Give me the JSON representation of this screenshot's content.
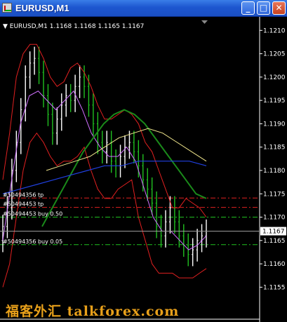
{
  "window": {
    "title": "EURUSD,M1",
    "buttons": {
      "minimize": "_",
      "maximize": "□",
      "close": "✕"
    }
  },
  "chart_info": "▼ EURUSD,M1  1.1168 1.1168 1.1165 1.1167",
  "watermark": "福客外汇 talkforex.com",
  "price_axis": {
    "labels": [
      "1.1210",
      "1.1205",
      "1.1200",
      "1.1195",
      "1.1190",
      "1.1185",
      "1.1180",
      "1.1175",
      "1.1170",
      "1.1165",
      "1.1160",
      "1.1155"
    ],
    "current_price": "1.1167"
  },
  "order_lines": [
    {
      "label": "#50494356 tp",
      "price": 1.11741,
      "color": "#e02020",
      "show_label": true
    },
    {
      "label": "#50494453 tp",
      "price": 1.11721,
      "color": "#e02020",
      "show_label": true
    },
    {
      "label": "#50494453 buy 0.50",
      "price": 1.117,
      "color": "#20c020",
      "show_label": true
    },
    {
      "label": "#50494356 buy 0.05",
      "price": 1.11641,
      "color": "#20c020",
      "show_label": true
    }
  ],
  "colors": {
    "background": "#000000",
    "up_bar": "#ffffff",
    "down_bar": "#20c020",
    "bollinger": "#e02020",
    "ma_fast": "#ffffff",
    "ma_violet": "#d070ff",
    "ma_green": "#1a8a1a",
    "ma_khaki": "#f0e68c",
    "ma_blue": "#2040e0"
  },
  "chart_data": {
    "type": "line",
    "ylim": [
      1.1151,
      1.1212
    ],
    "x_count": 60,
    "series": [
      {
        "key": "close",
        "values": [
          1.1168,
          1.1172,
          1.118,
          1.1186,
          1.1193,
          1.12,
          1.1203,
          1.1204,
          1.1201,
          1.1196,
          1.1192,
          1.1188,
          1.1191,
          1.1194,
          1.1196,
          1.1195,
          1.1198,
          1.12,
          1.1198,
          1.1194,
          1.119,
          1.1186,
          1.1184,
          1.1186,
          1.1182,
          1.1181,
          1.1183,
          1.1185,
          1.1186,
          1.1184,
          1.1181,
          1.1178,
          1.1176,
          1.1173,
          1.1168,
          1.1166,
          1.1169,
          1.1172,
          1.1169,
          1.1166,
          1.1164,
          1.1162,
          1.1163,
          1.1165,
          1.1166,
          1.1167
        ]
      },
      {
        "key": "bb_upper",
        "values": [
          1.1178,
          1.1188,
          1.12,
          1.1205,
          1.1207,
          1.1207,
          1.1204,
          1.12,
          1.1198,
          1.1199,
          1.1202,
          1.1203,
          1.1201,
          1.1198,
          1.1194,
          1.1191,
          1.1191,
          1.1192,
          1.1193,
          1.1192,
          1.119,
          1.1186,
          1.1184,
          1.118,
          1.1176,
          1.1172,
          1.1172,
          1.1174,
          1.1173,
          1.1172,
          1.117
        ]
      },
      {
        "key": "bb_lower",
        "values": [
          1.1155,
          1.116,
          1.117,
          1.118,
          1.1186,
          1.1188,
          1.1186,
          1.1183,
          1.1181,
          1.1182,
          1.1182,
          1.1183,
          1.1185,
          1.118,
          1.1176,
          1.1174,
          1.1174,
          1.1176,
          1.1177,
          1.1178,
          1.117,
          1.1165,
          1.116,
          1.1158,
          1.1158,
          1.1158,
          1.1157,
          1.1157,
          1.1157,
          1.1158,
          1.1159
        ]
      },
      {
        "key": "ma_violet",
        "values": [
          1.1165,
          1.1178,
          1.119,
          1.1196,
          1.1197,
          1.1195,
          1.1193,
          1.1195,
          1.1197,
          1.1193,
          1.1188,
          1.1185,
          1.1183,
          1.1183,
          1.1185,
          1.1182,
          1.1176,
          1.117,
          1.1167,
          1.1167,
          1.1165,
          1.1163,
          1.1164,
          1.1166
        ]
      },
      {
        "key": "ma_green",
        "values": [
          1.1168,
          1.1172,
          1.1176,
          1.118,
          1.1184,
          1.1187,
          1.119,
          1.1192,
          1.1193,
          1.1192,
          1.119,
          1.1187,
          1.1184,
          1.1181,
          1.1178,
          1.1175,
          1.1174
        ]
      },
      {
        "key": "ma_khaki",
        "values": [
          1.118,
          1.1181,
          1.1182,
          1.1183,
          1.1185,
          1.1187,
          1.1188,
          1.1189,
          1.1188,
          1.1186,
          1.1184,
          1.1182
        ]
      },
      {
        "key": "ma_blue",
        "values": [
          1.1175,
          1.1176,
          1.1177,
          1.1178,
          1.1179,
          1.118,
          1.1181,
          1.1181,
          1.1182,
          1.1182,
          1.1182,
          1.1182,
          1.1181
        ]
      }
    ]
  }
}
